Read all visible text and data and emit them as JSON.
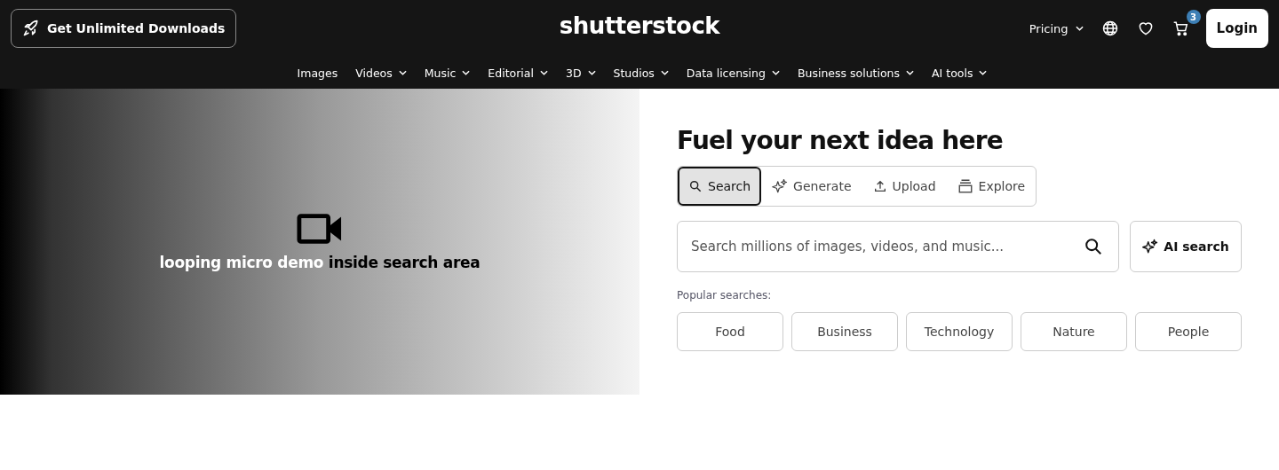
{
  "header": {
    "promo_button": "Get Unlimited Downloads",
    "logo": "shutterstock",
    "pricing": "Pricing",
    "cart_count": "3",
    "login": "Login"
  },
  "nav": [
    {
      "label": "Images",
      "has_menu": false
    },
    {
      "label": "Videos",
      "has_menu": true
    },
    {
      "label": "Music",
      "has_menu": true
    },
    {
      "label": "Editorial",
      "has_menu": true
    },
    {
      "label": "3D",
      "has_menu": true
    },
    {
      "label": "Studios",
      "has_menu": true
    },
    {
      "label": "Data licensing",
      "has_menu": true
    },
    {
      "label": "Business solutions",
      "has_menu": true
    },
    {
      "label": "AI tools",
      "has_menu": true
    }
  ],
  "demo": {
    "caption_light": "looping micro demo",
    "caption_dark": "inside search area"
  },
  "hero": {
    "title": "Fuel your next idea here",
    "modes": [
      {
        "kind": "search",
        "label": "Search",
        "selected": true
      },
      {
        "kind": "generate",
        "label": "Generate",
        "selected": false
      },
      {
        "kind": "upload",
        "label": "Upload",
        "selected": false
      },
      {
        "kind": "explore",
        "label": "Explore",
        "selected": false
      }
    ],
    "search": {
      "placeholder": "Search millions of images, videos, and music..."
    },
    "ai_button": "AI search",
    "popular_label": "Popular searches:",
    "popular": [
      "Food",
      "Business",
      "Technology",
      "Nature",
      "People"
    ]
  }
}
